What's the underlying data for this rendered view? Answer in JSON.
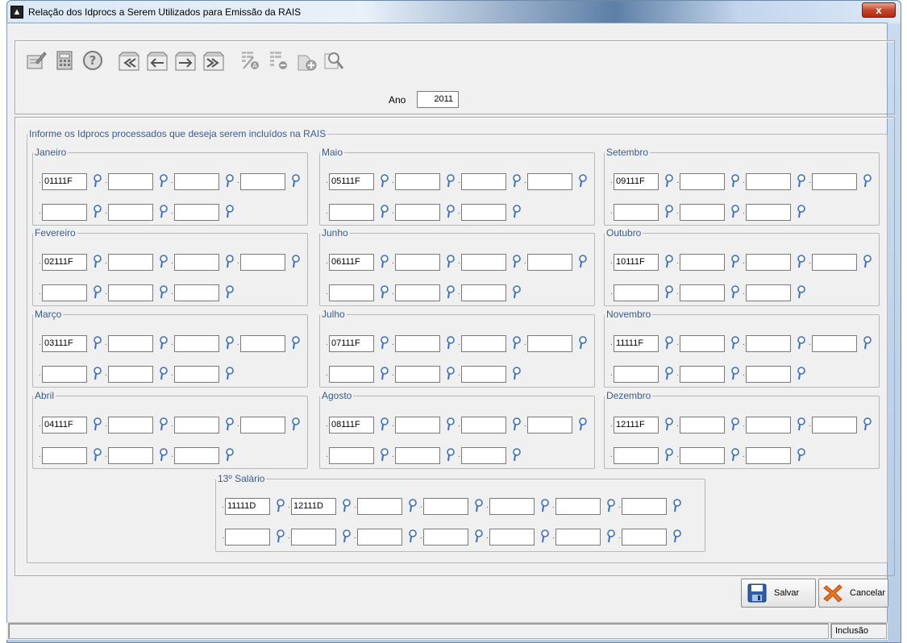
{
  "window": {
    "title": "Relação dos Idprocs a Serem Utilizados para Emissão da RAIS",
    "close_label": "x"
  },
  "toolbar": {
    "icons": [
      "edit-icon",
      "calculator-icon",
      "help-icon",
      "first-record-icon",
      "previous-record-icon",
      "next-record-icon",
      "last-record-icon",
      "add-record-icon",
      "remove-record-icon",
      "new-document-icon",
      "search-icon"
    ]
  },
  "year": {
    "label": "Ano",
    "value": "2011"
  },
  "group": {
    "title": "Informe os Idprocs processados que deseja serem incluídos na RAIS"
  },
  "months": [
    {
      "name": "Janeiro",
      "values": [
        "01111F",
        "",
        "",
        "",
        "",
        "",
        ""
      ]
    },
    {
      "name": "Fevereiro",
      "values": [
        "02111F",
        "",
        "",
        "",
        "",
        "",
        ""
      ]
    },
    {
      "name": "Março",
      "values": [
        "03111F",
        "",
        "",
        "",
        "",
        "",
        ""
      ]
    },
    {
      "name": "Abril",
      "values": [
        "04111F",
        "",
        "",
        "",
        "",
        "",
        ""
      ]
    },
    {
      "name": "Maio",
      "values": [
        "05111F",
        "",
        "",
        "",
        "",
        "",
        ""
      ]
    },
    {
      "name": "Junho",
      "values": [
        "06111F",
        "",
        "",
        "",
        "",
        "",
        ""
      ]
    },
    {
      "name": "Julho",
      "values": [
        "07111F",
        "",
        "",
        "",
        "",
        "",
        ""
      ]
    },
    {
      "name": "Agosto",
      "values": [
        "08111F",
        "",
        "",
        "",
        "",
        "",
        ""
      ]
    },
    {
      "name": "Setembro",
      "values": [
        "09111F",
        "",
        "",
        "",
        "",
        "",
        ""
      ]
    },
    {
      "name": "Outubro",
      "values": [
        "10111F",
        "",
        "",
        "",
        "",
        "",
        ""
      ]
    },
    {
      "name": "Novembro",
      "values": [
        "11111F",
        "",
        "",
        "",
        "",
        "",
        ""
      ]
    },
    {
      "name": "Dezembro",
      "values": [
        "12111F",
        "",
        "",
        "",
        "",
        "",
        ""
      ]
    }
  ],
  "salario13": {
    "name": "13º Salário",
    "values": [
      "11111D",
      "12111D",
      "",
      "",
      "",
      "",
      "",
      "",
      "",
      "",
      "",
      "",
      "",
      ""
    ]
  },
  "buttons": {
    "save": "Salvar",
    "cancel": "Cancelar"
  },
  "status": {
    "mode": "Inclusão"
  },
  "colors": {
    "accent": "#3a5c8c",
    "titlebar": "#5d7fa6",
    "close": "#c8462b"
  }
}
